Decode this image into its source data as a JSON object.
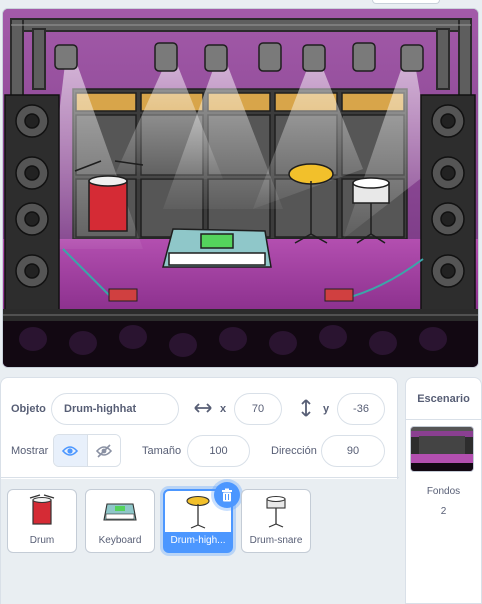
{
  "sprite_info": {
    "object_label": "Objeto",
    "sprite_name": "Drum-highhat",
    "x_label": "x",
    "x_value": "70",
    "y_label": "y",
    "y_value": "-36",
    "show_label": "Mostrar",
    "size_label": "Tamaño",
    "size_value": "100",
    "direction_label": "Dirección",
    "direction_value": "90"
  },
  "sprites": [
    {
      "name": "Drum",
      "icon": "drum-icon",
      "selected": false
    },
    {
      "name": "Keyboard",
      "icon": "keyboard-icon",
      "selected": false
    },
    {
      "name": "Drum-highhat",
      "display": "Drum-high...",
      "icon": "highhat-icon",
      "selected": true
    },
    {
      "name": "Drum-snare",
      "icon": "snare-icon",
      "selected": false
    }
  ],
  "stage_panel": {
    "title": "Escenario",
    "backdrops_label": "Fondos",
    "backdrops_count": "2"
  },
  "colors": {
    "accent": "#4c97ff",
    "text": "#575e75",
    "stage_floor": "#9b3f9c",
    "stage_wall": "#7b3e86"
  }
}
